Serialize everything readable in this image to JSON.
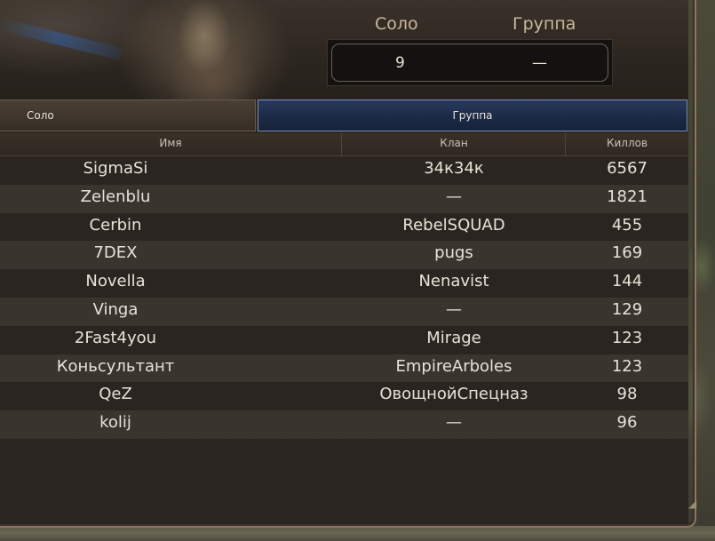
{
  "summary": {
    "solo_label": "Соло",
    "group_label": "Группа",
    "solo_value": "9",
    "group_value": "—"
  },
  "tabs": [
    {
      "label": "Соло",
      "active": false
    },
    {
      "label": "Группа",
      "active": true
    }
  ],
  "table": {
    "headers": {
      "name": "Имя",
      "clan": "Клан",
      "kills": "Киллов"
    },
    "rows": [
      {
        "name": "SigmaSi",
        "clan": "34к34к",
        "kills": "6567"
      },
      {
        "name": "Zelenblu",
        "clan": "—",
        "kills": "1821"
      },
      {
        "name": "Cerbin",
        "clan": "RebelSQUAD",
        "kills": "455"
      },
      {
        "name": "7DEX",
        "clan": "pugs",
        "kills": "169"
      },
      {
        "name": "Novella",
        "clan": "Nenavist",
        "kills": "144"
      },
      {
        "name": "Vinga",
        "clan": "—",
        "kills": "129"
      },
      {
        "name": "2Fast4you",
        "clan": "Mirage",
        "kills": "123"
      },
      {
        "name": "Коньсультант",
        "clan": "EmpireArboles",
        "kills": "123"
      },
      {
        "name": "QeZ",
        "clan": "ОвощнойСпецназ",
        "kills": "98"
      },
      {
        "name": "kolij",
        "clan": "—",
        "kills": "96"
      }
    ]
  },
  "colors": {
    "active_tab": "#1b2a46",
    "text": "#e8e2d6",
    "label": "#c9b89a"
  }
}
